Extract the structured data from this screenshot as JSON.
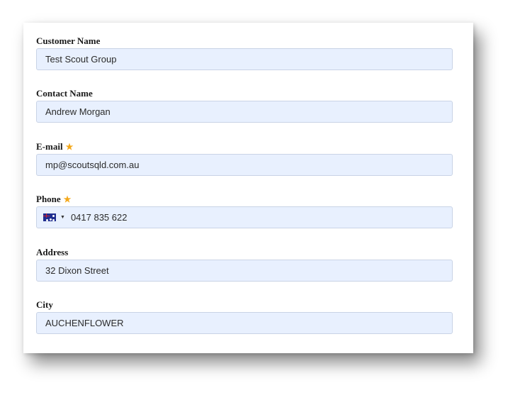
{
  "form": {
    "fields": [
      {
        "label": "Customer Name",
        "value": "Test Scout Group",
        "required": false
      },
      {
        "label": "Contact Name",
        "value": "Andrew Morgan",
        "required": false
      },
      {
        "label": "E-mail",
        "value": "mp@scoutsqld.com.au",
        "required": true
      },
      {
        "label": "Phone",
        "value": "0417 835 622",
        "required": true,
        "country": "AU"
      },
      {
        "label": "Address",
        "value": "32 Dixon Street",
        "required": false
      },
      {
        "label": "City",
        "value": "AUCHENFLOWER",
        "required": false
      }
    ]
  },
  "colors": {
    "input_background": "#e8f0fe",
    "required_star": "#f4a81a"
  },
  "icons": {
    "required": "star-icon",
    "country_flag": "australia-flag-icon",
    "dropdown": "caret-down-icon"
  }
}
